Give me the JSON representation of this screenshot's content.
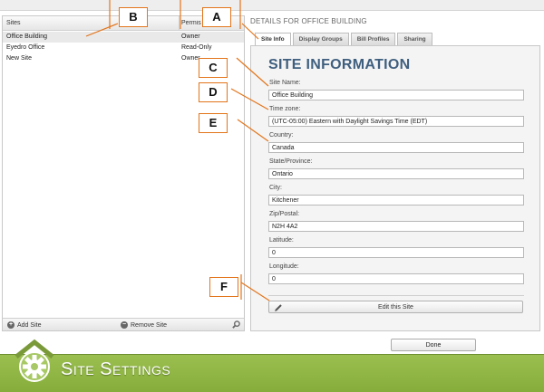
{
  "sites_list": {
    "headers": [
      "Sites",
      "Permissions"
    ],
    "rows": [
      {
        "name": "Office Building",
        "permission": "Owner"
      },
      {
        "name": "Eyedro Office",
        "permission": "Read-Only"
      },
      {
        "name": "New Site",
        "permission": "Owner"
      }
    ],
    "footer": {
      "add_label": "Add Site",
      "remove_label": "Remove Site",
      "add_icon": "plus-icon",
      "remove_icon": "minus-icon",
      "search_icon": "magnifier-icon"
    }
  },
  "details": {
    "title": "DETAILS FOR OFFICE BUILDING",
    "tabs": [
      "Site Info",
      "Display Groups",
      "Bill Profiles",
      "Sharing"
    ],
    "active_tab": "Site Info",
    "heading": "SITE INFORMATION",
    "fields": {
      "site_name": {
        "label": "Site Name:",
        "value": "Office Building"
      },
      "time_zone": {
        "label": "Time zone:",
        "value": "(UTC-05:00) Eastern with Daylight Savings Time (EDT)"
      },
      "country": {
        "label": "Country:",
        "value": "Canada"
      },
      "state": {
        "label": "State/Province:",
        "value": "Ontario"
      },
      "city": {
        "label": "City:",
        "value": "Kitchener"
      },
      "zip": {
        "label": "Zip/Postal:",
        "value": "N2H 4A2"
      },
      "latitude": {
        "label": "Latitude:",
        "value": "0"
      },
      "longitude": {
        "label": "Longitude:",
        "value": "0"
      }
    },
    "edit_button": "Edit this Site",
    "edit_icon": "pencil-icon"
  },
  "done_button": "Done",
  "callouts": [
    "A",
    "B",
    "C",
    "D",
    "E",
    "F"
  ],
  "banner": {
    "title": "Site Settings",
    "icon": "gear-icon"
  },
  "colors": {
    "callout_border": "#e3751b",
    "banner_green": "#8cb342",
    "heading_blue": "#3f5f7f"
  }
}
